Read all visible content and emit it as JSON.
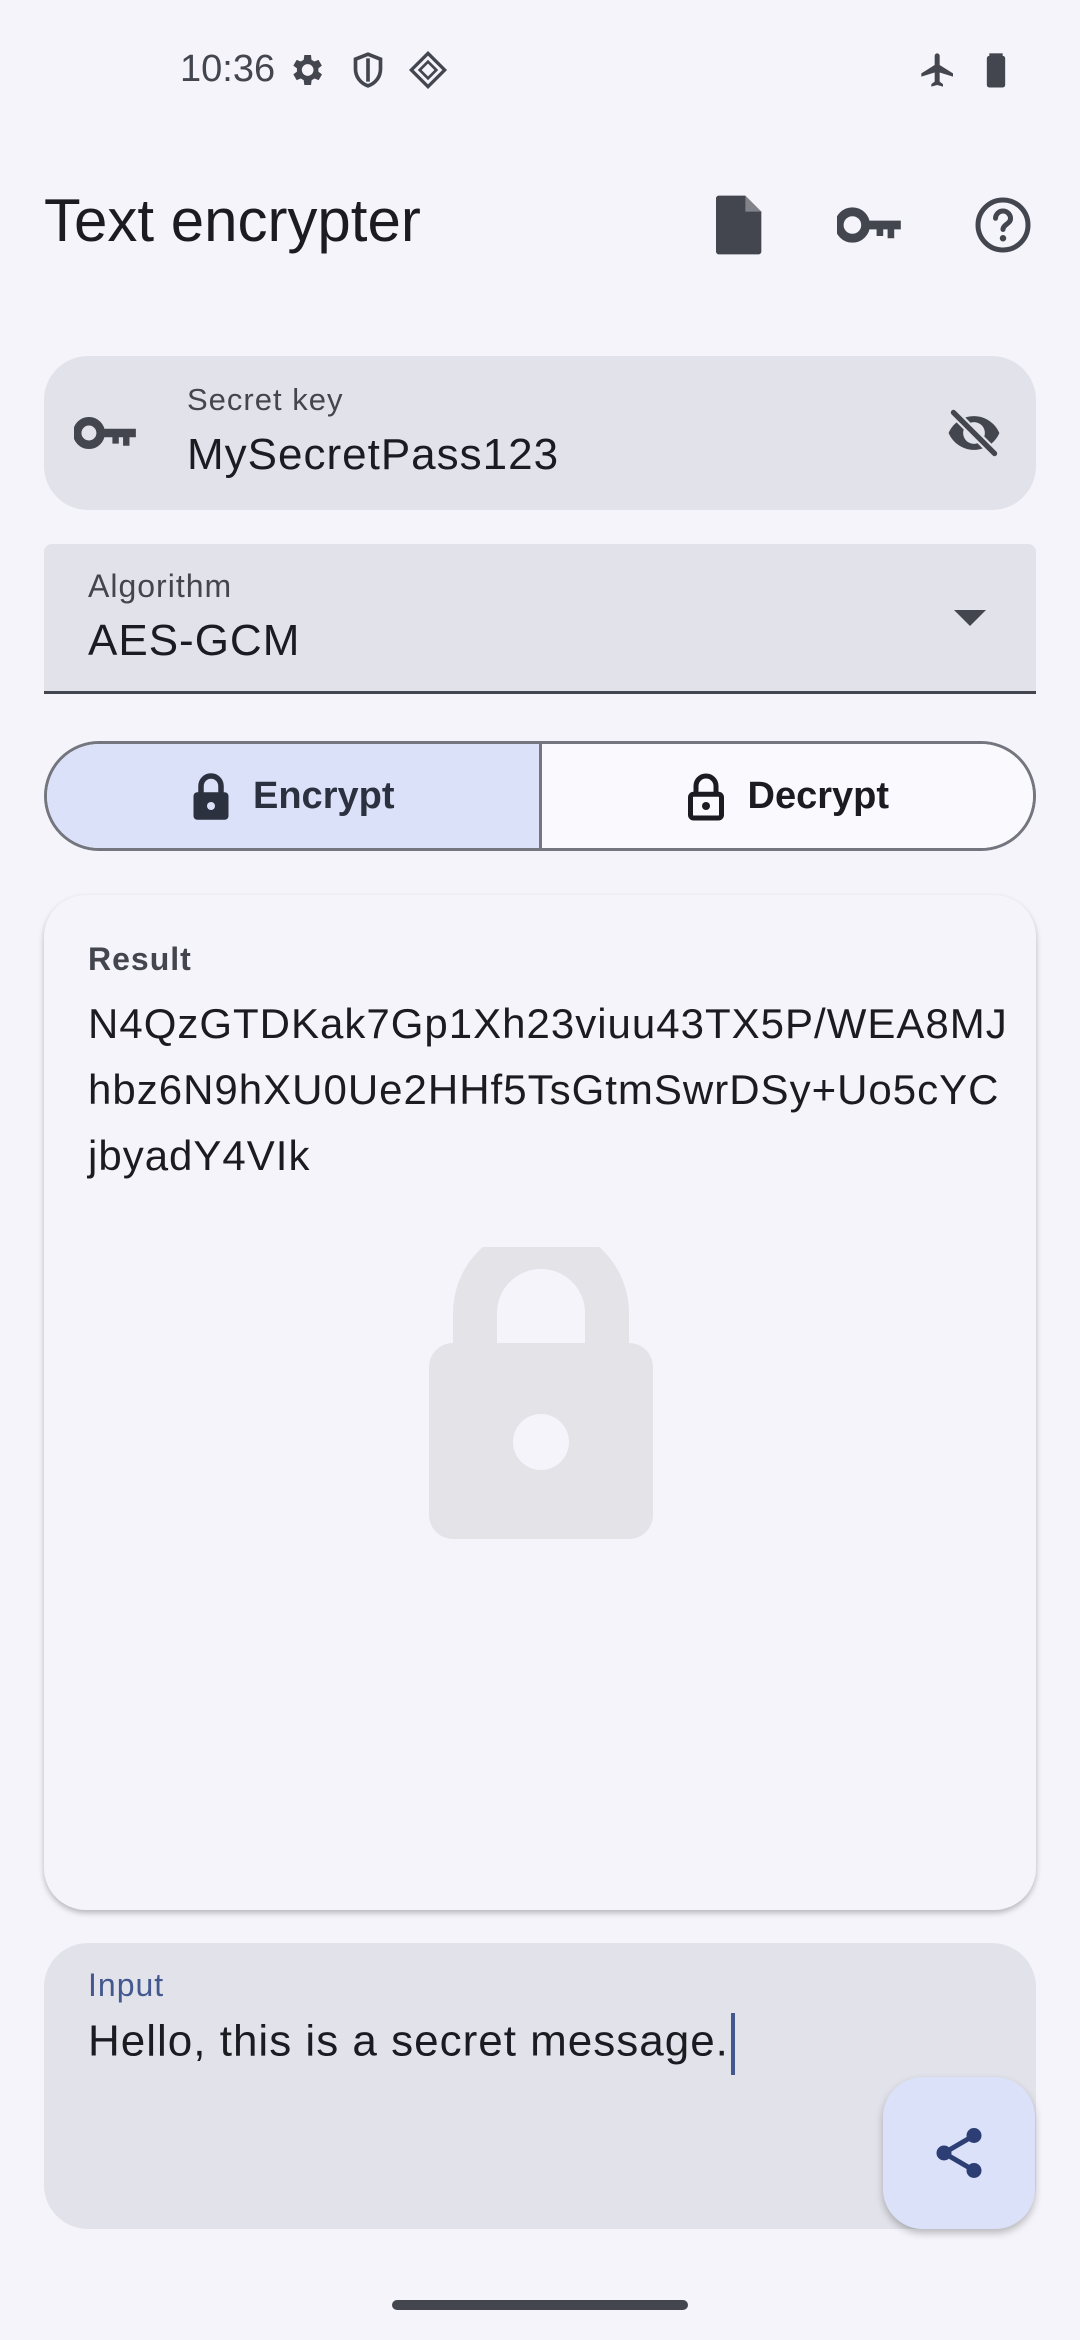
{
  "status_bar": {
    "time": "10:36",
    "icons_left": [
      "gear-icon",
      "shield-icon",
      "vpn-diamond-icon"
    ],
    "icons_right": [
      "airplane-icon",
      "battery-icon"
    ]
  },
  "app_bar": {
    "title": "Text encrypter",
    "actions": [
      "file-icon",
      "key-icon",
      "help-icon"
    ]
  },
  "secret_key": {
    "label": "Secret key",
    "value": "MySecretPass123",
    "leading_icon": "key-icon",
    "trailing_icon": "visibility-off-icon"
  },
  "algorithm": {
    "label": "Algorithm",
    "value": "AES-GCM"
  },
  "mode": {
    "encrypt_label": "Encrypt",
    "decrypt_label": "Decrypt",
    "selected": "Encrypt"
  },
  "result": {
    "label": "Result",
    "text": "N4QzGTDKak7Gp1Xh23viuu43TX5P/WEA8MJhbz6N9hXU0Ue2HHf5TsGtmSwrDSy+Uo5cYCjbyadY4VIk"
  },
  "input": {
    "label": "Input",
    "value": "Hello, this is a secret message."
  },
  "fab": {
    "icon": "share-icon"
  },
  "colors": {
    "background": "#f4f4fa",
    "field": "#e2e2ea",
    "selected_segment": "#dbe1f9",
    "accent": "#43588f"
  }
}
